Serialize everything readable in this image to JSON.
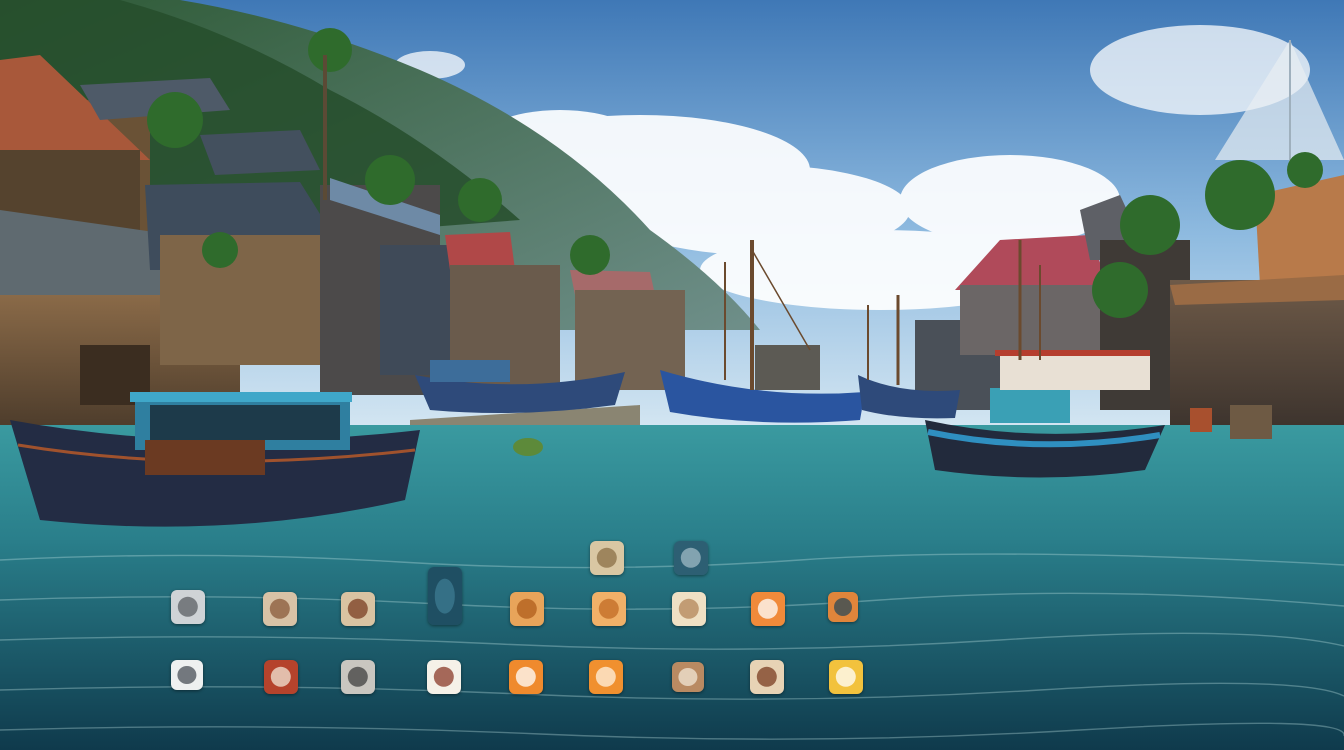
{
  "scene": {
    "description_colors": {
      "sky_top": "#3f78b6",
      "sky_bottom": "#bcd9ee",
      "water_top": "#2f8f97",
      "water_bottom": "#123f52",
      "hill": "#2f5a3c"
    }
  },
  "desktop": {
    "icons": [
      {
        "id": "icon-r0-a",
        "icon": "beige-circle-icon",
        "color": "#d9c7a3",
        "accent": "#8a6f45",
        "lines": []
      },
      {
        "id": "icon-r0-b",
        "icon": "teal-square-icon",
        "color": "#2d5f73",
        "accent": "#9fb9c4",
        "lines": []
      },
      {
        "id": "icon-r1-a",
        "icon": "document-icon",
        "color": "#cfd3d6",
        "accent": "#5b5f63",
        "lines": [
          "",
          ""
        ]
      },
      {
        "id": "icon-r1-b",
        "icon": "photo-icon",
        "color": "#d8c2a6",
        "accent": "#8a5a3a",
        "lines": [
          "",
          ""
        ]
      },
      {
        "id": "icon-r1-c",
        "icon": "coin-icon",
        "color": "#d9c3a2",
        "accent": "#7a3e22",
        "lines": [
          "",
          ""
        ]
      },
      {
        "id": "icon-r1-d",
        "icon": "tall-box-icon",
        "color": "#1f4f63",
        "accent": "#3e7b91",
        "lines": [
          "",
          ""
        ]
      },
      {
        "id": "icon-r1-e",
        "icon": "orange-badge-icon",
        "color": "#e8a45a",
        "accent": "#b05e1c",
        "lines": [
          "",
          ""
        ]
      },
      {
        "id": "icon-r1-f",
        "icon": "orange-ring-icon",
        "color": "#f0b068",
        "accent": "#c26b24",
        "lines": [
          "",
          ""
        ]
      },
      {
        "id": "icon-r1-g",
        "icon": "cream-dial-icon",
        "color": "#efe0c4",
        "accent": "#b3865a",
        "lines": [
          "",
          ""
        ]
      },
      {
        "id": "icon-r1-h",
        "icon": "orange-map-icon",
        "color": "#f08a3a",
        "accent": "#ffffff",
        "lines": [
          "",
          ""
        ]
      },
      {
        "id": "icon-r1-i",
        "icon": "orange-frame-icon",
        "color": "#e0853b",
        "accent": "#2c4a58",
        "lines": [
          "",
          ""
        ]
      },
      {
        "id": "icon-r2-a",
        "icon": "white-shell-icon",
        "color": "#eef0f0",
        "accent": "#4a5058",
        "lines": [
          "",
          "",
          ""
        ]
      },
      {
        "id": "icon-r2-b",
        "icon": "red-card-icon",
        "color": "#b5432c",
        "accent": "#f1e5d5",
        "lines": [
          "",
          "",
          ""
        ]
      },
      {
        "id": "icon-r2-c",
        "icon": "grey-sketch-icon",
        "color": "#c9c6c0",
        "accent": "#3f3f3f",
        "lines": [
          "",
          "",
          ""
        ]
      },
      {
        "id": "icon-r2-d",
        "icon": "white-sketch-icon",
        "color": "#f5f1e8",
        "accent": "#8a3a2a",
        "lines": [
          "",
          "",
          ""
        ]
      },
      {
        "id": "icon-r2-e",
        "icon": "orange-white-icon",
        "color": "#ef8a2d",
        "accent": "#ffffff",
        "lines": [
          "",
          "",
          ""
        ]
      },
      {
        "id": "icon-r2-f",
        "icon": "orange-figure-icon",
        "color": "#f0902f",
        "accent": "#fff2e0",
        "lines": [
          "",
          "",
          ""
        ]
      },
      {
        "id": "icon-r2-g",
        "icon": "brown-figure-icon",
        "color": "#b98a62",
        "accent": "#f2e6d6",
        "lines": [
          "",
          "",
          ""
        ]
      },
      {
        "id": "icon-r2-h",
        "icon": "beige-list-icon",
        "color": "#e7d3b5",
        "accent": "#7a3c22",
        "lines": [
          "",
          "",
          ""
        ]
      },
      {
        "id": "icon-r2-i",
        "icon": "yellow-bubble-icon",
        "color": "#f2c23d",
        "accent": "#ffffff",
        "lines": [
          "",
          "",
          ""
        ]
      }
    ]
  }
}
